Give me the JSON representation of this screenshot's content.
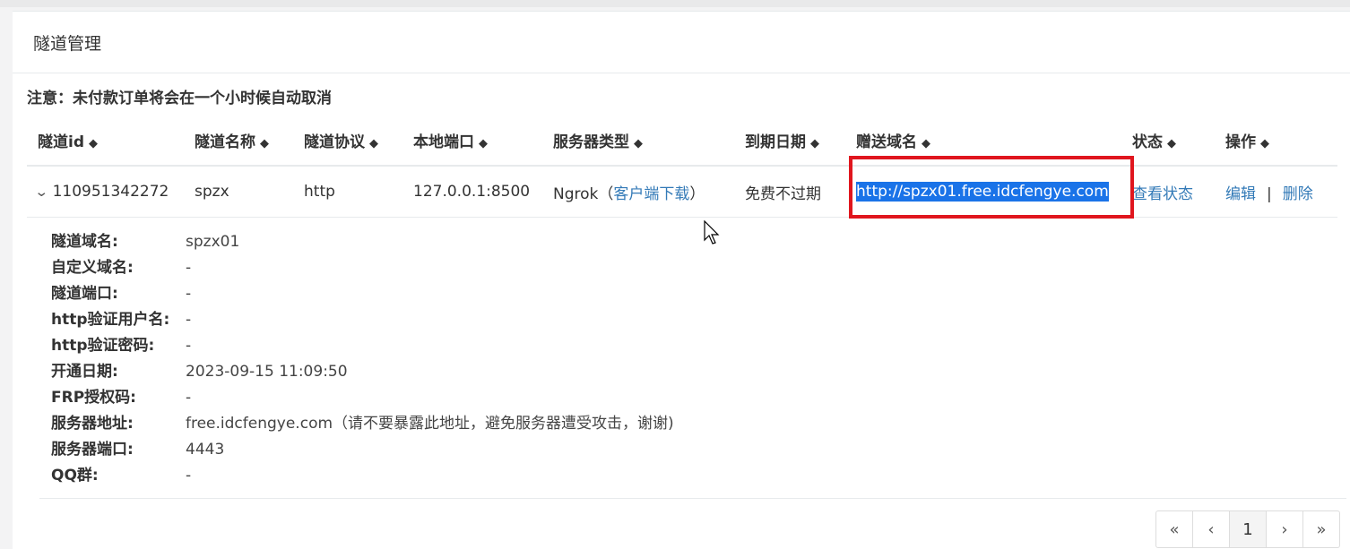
{
  "header": {
    "title": "隧道管理"
  },
  "notice": "注意：未付款订单将会在一个小时候自动取消",
  "table": {
    "columns": [
      "隧道id",
      "隧道名称",
      "隧道协议",
      "本地端口",
      "服务器类型",
      "到期日期",
      "赠送域名",
      "状态",
      "操作"
    ],
    "sort_icon": "sort-icon",
    "row": {
      "id": "110951342272",
      "name": "spzx",
      "protocol": "http",
      "local_port": "127.0.0.1:8500",
      "server_type": "Ngrok",
      "download_open": "（",
      "download_link": "客户端下载",
      "download_close": "）",
      "expire": "免费不过期",
      "domain": "http://spzx01.free.idcfengye.com",
      "status_link": "查看状态",
      "edit": "编辑",
      "sep": "|",
      "delete": "删除"
    }
  },
  "details": [
    {
      "label": "隧道域名:",
      "value": "spzx01"
    },
    {
      "label": "自定义域名:",
      "value": "-"
    },
    {
      "label": "隧道端口:",
      "value": "-"
    },
    {
      "label": "http验证用户名:",
      "value": "-"
    },
    {
      "label": "http验证密码:",
      "value": "-"
    },
    {
      "label": "开通日期:",
      "value": "2023-09-15 11:09:50"
    },
    {
      "label": "FRP授权码:",
      "value": "-"
    },
    {
      "label": "服务器地址:",
      "value": "free.idcfengye.com（请不要暴露此地址，避免服务器遭受攻击，谢谢)"
    },
    {
      "label": "服务器端口:",
      "value": "4443"
    },
    {
      "label": "QQ群:",
      "value": "-"
    }
  ],
  "pager": {
    "first": "«",
    "prev": "‹",
    "page": "1",
    "next": "›",
    "last": "»"
  },
  "colors": {
    "link": "#337ab7",
    "highlight": "#e0161e",
    "selection": "#1a73e8"
  }
}
